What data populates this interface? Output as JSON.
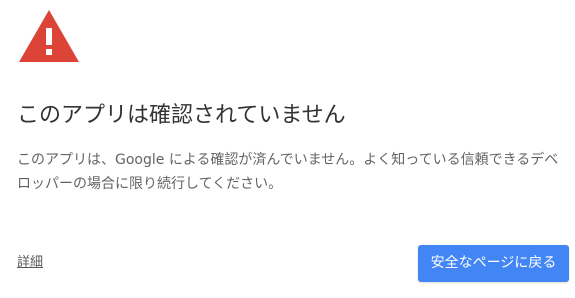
{
  "icon": {
    "name": "warning-icon",
    "color": "#db4437",
    "mark_color": "#ffffff"
  },
  "warning": {
    "title": "このアプリは確認されていません",
    "description": "このアプリは、Google による確認が済んでいません。よく知っている信頼できるデベロッパーの場合に限り続行してください。"
  },
  "actions": {
    "details_label": "詳細",
    "back_to_safety_label": "安全なページに戻る",
    "button_color": "#4285f4"
  }
}
